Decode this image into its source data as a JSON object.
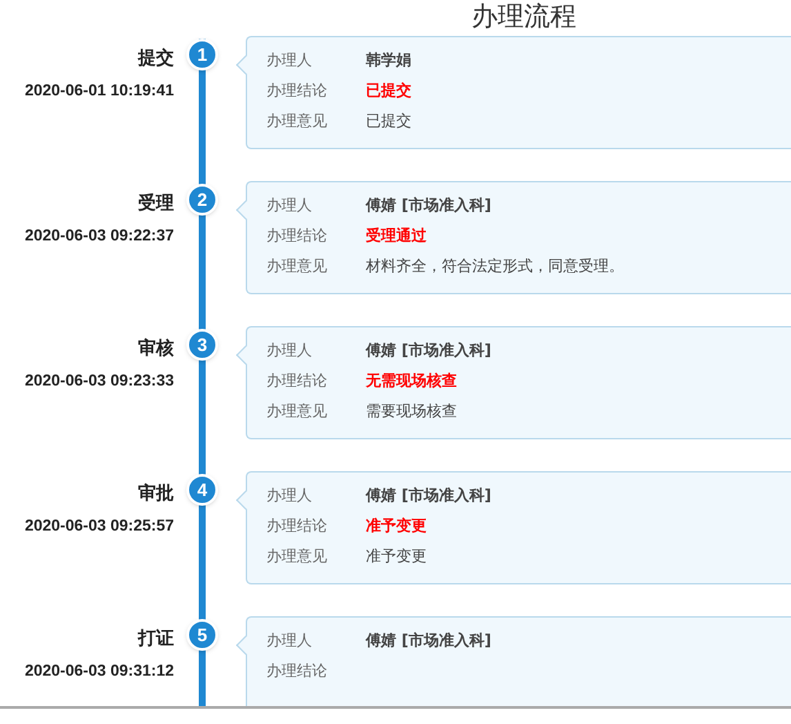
{
  "title": "办理流程",
  "steps": [
    {
      "number": "1",
      "name": "提交",
      "time": "2020-06-01 10:19:41",
      "rows": [
        {
          "kind": "handler",
          "label": "办理人",
          "value": "韩学娟"
        },
        {
          "kind": "conclusion",
          "label": "办理结论",
          "value": "已提交"
        },
        {
          "kind": "opinion",
          "label": "办理意见",
          "value": "已提交"
        }
      ]
    },
    {
      "number": "2",
      "name": "受理",
      "time": "2020-06-03 09:22:37",
      "rows": [
        {
          "kind": "handler",
          "label": "办理人",
          "value": "傅婧 [市场准入科]"
        },
        {
          "kind": "conclusion",
          "label": "办理结论",
          "value": "受理通过"
        },
        {
          "kind": "opinion",
          "label": "办理意见",
          "value": "材料齐全，符合法定形式，同意受理。"
        }
      ]
    },
    {
      "number": "3",
      "name": "审核",
      "time": "2020-06-03 09:23:33",
      "rows": [
        {
          "kind": "handler",
          "label": "办理人",
          "value": "傅婧 [市场准入科]"
        },
        {
          "kind": "conclusion",
          "label": "办理结论",
          "value": "无需现场核查"
        },
        {
          "kind": "opinion",
          "label": "办理意见",
          "value": "需要现场核查"
        }
      ]
    },
    {
      "number": "4",
      "name": "审批",
      "time": "2020-06-03 09:25:57",
      "rows": [
        {
          "kind": "handler",
          "label": "办理人",
          "value": "傅婧 [市场准入科]"
        },
        {
          "kind": "conclusion",
          "label": "办理结论",
          "value": "准予变更"
        },
        {
          "kind": "opinion",
          "label": "办理意见",
          "value": "准予变更"
        }
      ]
    },
    {
      "number": "5",
      "name": "打证",
      "time": "2020-06-03 09:31:12",
      "rows": [
        {
          "kind": "handler",
          "label": "办理人",
          "value": "傅婧 [市场准入科]"
        },
        {
          "kind": "conclusion",
          "label": "办理结论"
        }
      ]
    }
  ]
}
